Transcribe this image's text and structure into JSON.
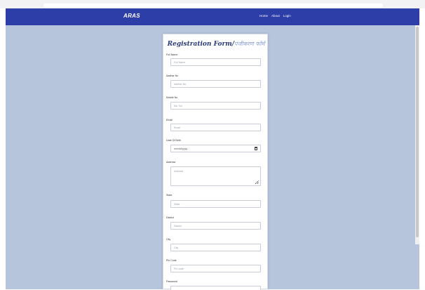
{
  "navbar": {
    "brand": "ARAS",
    "links": [
      "Home",
      "About",
      "Login"
    ]
  },
  "form": {
    "title": "Registration Form/",
    "title_hindi": "पंजीकरण फॉर्म",
    "fields": [
      {
        "label": "Full Name",
        "placeholder": "Full Name"
      },
      {
        "label": "Aadhar No",
        "placeholder": "Aadhar No"
      },
      {
        "label": "Mobile No",
        "placeholder": "Mo. No."
      },
      {
        "label": "Email",
        "placeholder": "Email"
      },
      {
        "label": "Date Of Birth",
        "placeholder": "mm/dd/yyyy"
      },
      {
        "label": "Address",
        "placeholder": "Address"
      },
      {
        "label": "State",
        "placeholder": "State"
      },
      {
        "label": "District",
        "placeholder": "District"
      },
      {
        "label": "City",
        "placeholder": "City"
      },
      {
        "label": "Pin Code",
        "placeholder": "Pin code"
      },
      {
        "label": "Password",
        "placeholder": ""
      }
    ]
  },
  "colors": {
    "navbar": "#2d3ea8",
    "page_background": "#b6c4dc",
    "title": "#2a3a7c"
  }
}
